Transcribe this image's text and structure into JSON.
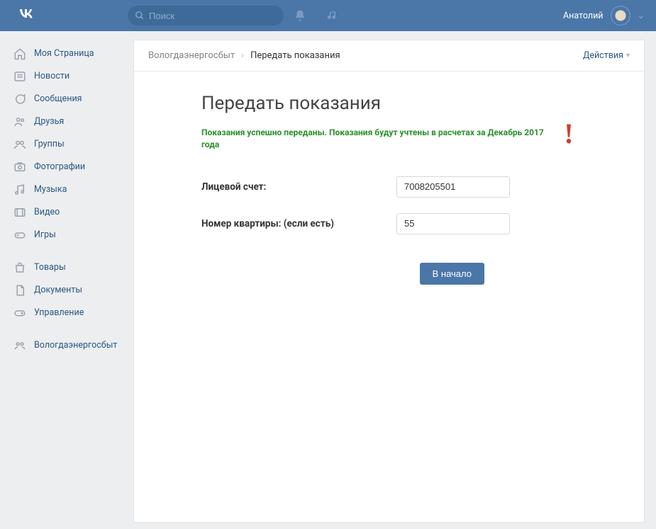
{
  "header": {
    "search_placeholder": "Поиск",
    "user_name": "Анатолий"
  },
  "sidebar": {
    "items": [
      {
        "label": "Моя Страница",
        "icon": "home"
      },
      {
        "label": "Новости",
        "icon": "news"
      },
      {
        "label": "Сообщения",
        "icon": "messages"
      },
      {
        "label": "Друзья",
        "icon": "friends"
      },
      {
        "label": "Группы",
        "icon": "groups"
      },
      {
        "label": "Фотографии",
        "icon": "photos"
      },
      {
        "label": "Музыка",
        "icon": "music"
      },
      {
        "label": "Видео",
        "icon": "video"
      },
      {
        "label": "Игры",
        "icon": "games"
      }
    ],
    "items2": [
      {
        "label": "Товары",
        "icon": "market"
      },
      {
        "label": "Документы",
        "icon": "docs"
      },
      {
        "label": "Управление",
        "icon": "manage"
      }
    ],
    "items3": [
      {
        "label": "Вологдаэнергосбыт",
        "icon": "group2"
      }
    ]
  },
  "main": {
    "breadcrumb_root": "Вологдаэнергосбыт",
    "breadcrumb_current": "Передать показания",
    "actions_label": "Действия",
    "title": "Передать показания",
    "success_message": "Показания успешно переданы. Показания будут учтены в расчетах за Декабрь 2017 года",
    "bang": "!",
    "account_label": "Лицевой счет:",
    "account_value": "7008205501",
    "apartment_label": "Номер квартиры: (если есть)",
    "apartment_value": "55",
    "button_label": "В начало"
  }
}
